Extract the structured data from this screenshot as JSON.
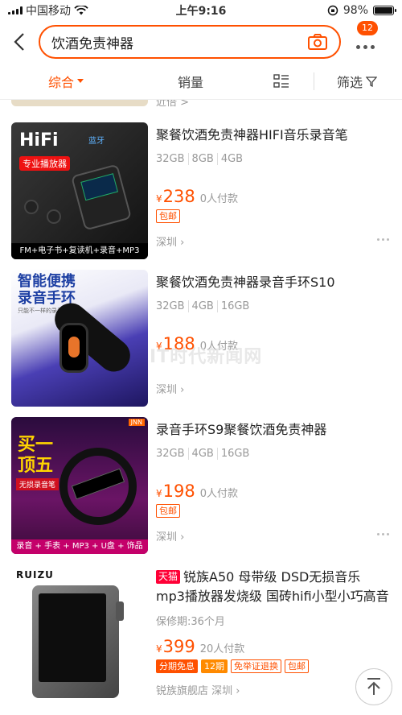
{
  "status_bar": {
    "carrier": "中国移动",
    "time": "上午9:16",
    "battery": "98%",
    "battery_level": 0.98
  },
  "search": {
    "query": "饮酒免责神器"
  },
  "header": {
    "cart_badge": "12"
  },
  "sort_tabs": [
    {
      "label": "综合",
      "active": true
    },
    {
      "label": "销量"
    },
    {
      "label": "筛选"
    }
  ],
  "partial_item": {
    "text": "近倍 >"
  },
  "products": [
    {
      "title": "聚餐饮酒免责神器HIFI音乐录音笔",
      "specs": [
        "32GB",
        "8GB",
        "4GB"
      ],
      "price": "238",
      "currency": "¥",
      "sold": "0人付款",
      "tags": [
        "包邮"
      ],
      "location": "深圳",
      "thumb": {
        "hifi": "HiFi",
        "bt": "蓝牙",
        "badge": "专业播放器",
        "bottom": "FM+电子书+复读机+录音+MP3"
      }
    },
    {
      "title": "聚餐饮酒免责神器录音手环S10",
      "specs": [
        "32GB",
        "4GB",
        "16GB"
      ],
      "price": "188",
      "currency": "¥",
      "sold": "0人付款",
      "tags": [],
      "location": "深圳",
      "thumb": {
        "headline_1": "智能便携",
        "headline_2": "录音手环",
        "sub": "只能不一样的录音笔"
      }
    },
    {
      "title": "录音手环S9聚餐饮酒免责神器",
      "specs": [
        "32GB",
        "4GB",
        "16GB"
      ],
      "price": "198",
      "currency": "¥",
      "sold": "0人付款",
      "tags": [
        "包邮"
      ],
      "location": "深圳",
      "thumb": {
        "brand": "JNN",
        "headline_1": "买一",
        "headline_2": "顶五",
        "badge": "无损录音笔",
        "bottom": "录音 + 手表 + MP3 + U盘 + 饰品"
      }
    },
    {
      "store_tag": "天猫",
      "title": "锐族A50 母带级 DSD无损音乐 mp3播放器发烧级 国砖hifi小型小巧高音",
      "warranty": "保修期:36个月",
      "price": "399",
      "currency": "¥",
      "sold": "20人付款",
      "tags": [
        "分期免息",
        "12期",
        "免举证退换",
        "包邮"
      ],
      "location": "锐族旗舰店 深圳",
      "thumb": {
        "logo": "RUIZU"
      }
    }
  ],
  "watermark": "IT时代新闻网",
  "colors": {
    "accent": "#ff5000",
    "tmall": "#ff0036"
  }
}
